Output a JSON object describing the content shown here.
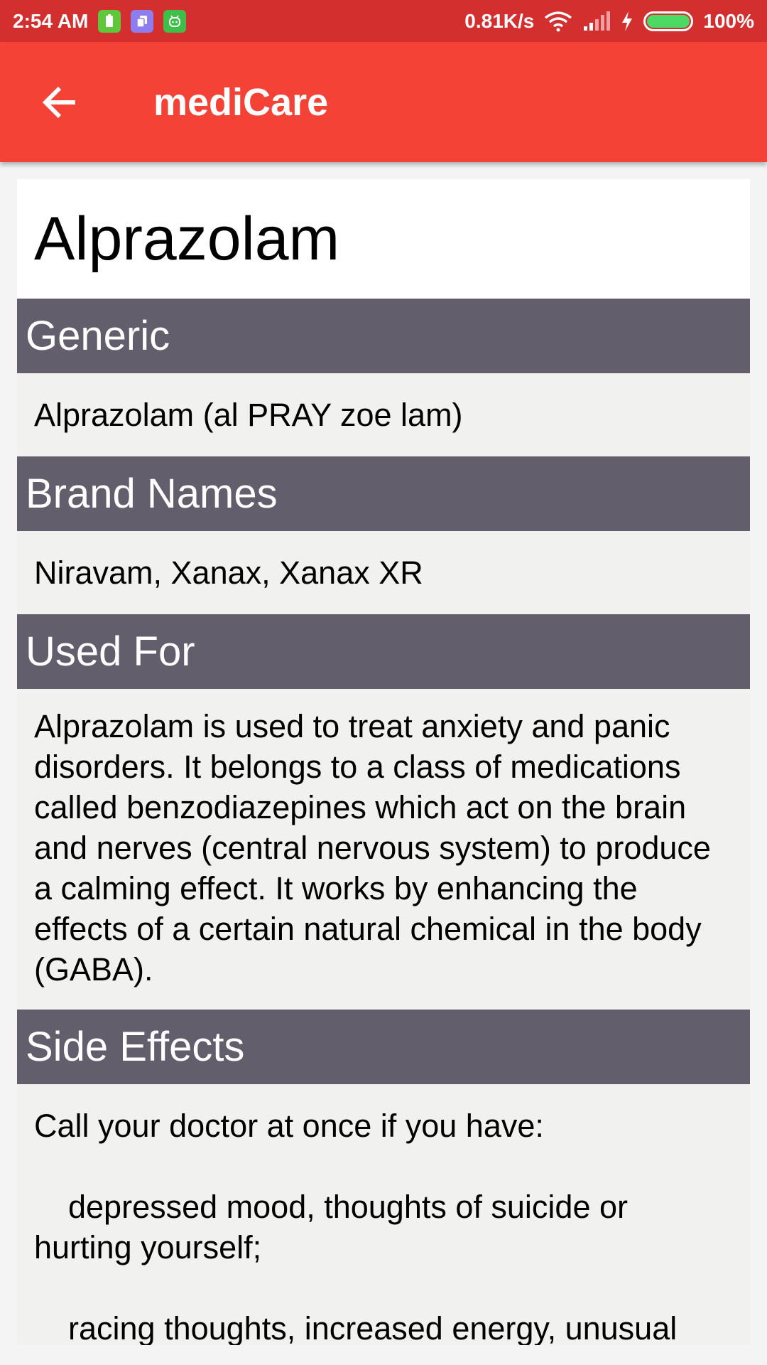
{
  "status_bar": {
    "time": "2:54 AM",
    "network_speed": "0.81K/s",
    "battery_percent": "100%",
    "battery_level": 1.0,
    "notification_icons": [
      "battery-app-icon",
      "layers-app-icon",
      "android-app-icon"
    ]
  },
  "app_bar": {
    "title": "mediCare",
    "back_icon": "arrow-left-icon"
  },
  "drug": {
    "name": "Alprazolam",
    "sections": {
      "generic": {
        "header": "Generic",
        "body": "Alprazolam (al PRAY zoe lam)"
      },
      "brand_names": {
        "header": "Brand Names",
        "body": "Niravam, Xanax, Xanax XR"
      },
      "used_for": {
        "header": "Used For",
        "body": "Alprazolam is used to treat anxiety and panic disorders. It belongs to a class of medications called benzodiazepines which act on the brain and nerves (central nervous system) to produce a calming effect. It works by enhancing the effects of a certain natural chemical in the body (GABA)."
      },
      "side_effects": {
        "header": "Side Effects",
        "intro": "Call your doctor at once if you have:",
        "item1": "depressed mood, thoughts of suicide or hurting yourself;",
        "item2": "racing thoughts, increased energy, unusual"
      }
    }
  },
  "colors": {
    "status_bar": "#d32f2f",
    "app_bar": "#f44336",
    "section_header": "#625e6b",
    "section_body": "#f1f2ef"
  }
}
